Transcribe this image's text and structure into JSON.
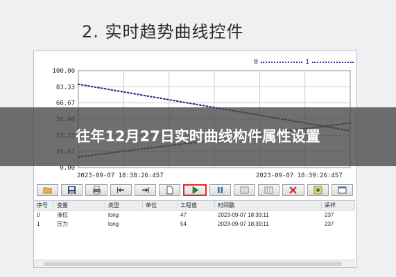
{
  "heading": "2. 实时趋势曲线控件",
  "overlay_title": "往年12月27日实时曲线构件属性设置",
  "legend": {
    "label_left": "0",
    "label_right": "1"
  },
  "time_axis": {
    "start": "2023-09-07 18:38:26:457",
    "end": "2023-09-07 18:39:26:457"
  },
  "toolbar": {
    "buttons": [
      {
        "name": "open",
        "icon": "folder-icon",
        "active": false
      },
      {
        "name": "save",
        "icon": "save-icon",
        "active": false
      },
      {
        "name": "print",
        "icon": "print-icon",
        "active": false
      },
      {
        "name": "back",
        "icon": "arrow-left-icon",
        "active": false
      },
      {
        "name": "forward",
        "icon": "arrow-right-icon",
        "active": false
      },
      {
        "name": "new",
        "icon": "page-icon",
        "active": false
      },
      {
        "name": "start",
        "icon": "play-icon",
        "active": true
      },
      {
        "name": "pause",
        "icon": "pause-icon",
        "active": false
      },
      {
        "name": "grid-a",
        "icon": "grid-icon",
        "active": false
      },
      {
        "name": "grid-b",
        "icon": "grid-icon",
        "active": false
      },
      {
        "name": "delete",
        "icon": "delete-icon",
        "active": false
      },
      {
        "name": "settings",
        "icon": "settings-icon",
        "active": false
      },
      {
        "name": "window",
        "icon": "window-icon",
        "active": false
      }
    ]
  },
  "table": {
    "headers": [
      "序号",
      "变量",
      "类型",
      "单位",
      "工程值",
      "时间戳",
      "采样"
    ],
    "rows": [
      [
        "0",
        "液位",
        "long",
        "",
        "47",
        "2023-09-07 18:39:11",
        "237"
      ],
      [
        "1",
        "压力",
        "long",
        "",
        "54",
        "2023-09-07 18:39:11",
        "237"
      ]
    ]
  },
  "chart_data": {
    "type": "line",
    "x": [
      0,
      60
    ],
    "ylim": [
      0,
      100
    ],
    "y_ticks": [
      "100.00",
      "83.33",
      "66.67",
      "50.00",
      "33.33",
      "16.67",
      "0.00"
    ],
    "grid": true,
    "series": [
      {
        "name": "0",
        "color": "#2a2f8f",
        "points": [
          [
            0,
            86
          ],
          [
            60,
            38
          ]
        ]
      },
      {
        "name": "1",
        "color": "#2a2f8f",
        "points": [
          [
            0,
            11
          ],
          [
            60,
            46
          ]
        ]
      }
    ]
  }
}
